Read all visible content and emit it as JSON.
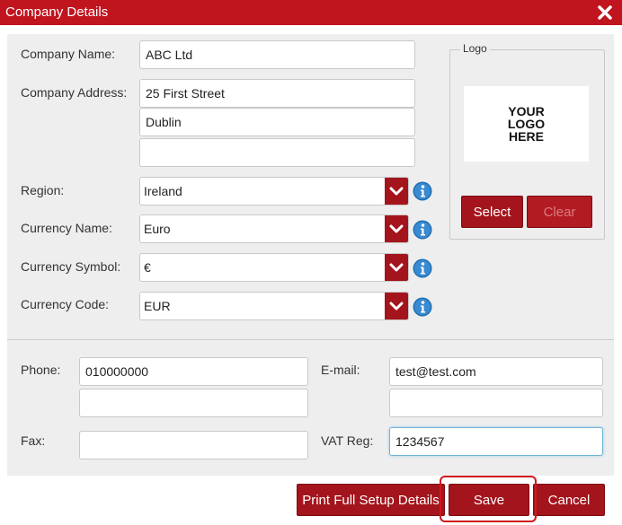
{
  "dialog": {
    "title": "Company Details",
    "close_icon": "close-icon"
  },
  "company": {
    "name_label": "Company Name:",
    "name_value": "ABC Ltd",
    "address_label": "Company Address:",
    "address_line1": "25 First Street",
    "address_line2": "Dublin",
    "address_line3": ""
  },
  "region": {
    "label": "Region:",
    "value": "Ireland"
  },
  "currency_name": {
    "label": "Currency Name:",
    "value": "Euro"
  },
  "currency_symbol": {
    "label": "Currency Symbol:",
    "value": "€"
  },
  "currency_code": {
    "label": "Currency Code:",
    "value": "EUR"
  },
  "logo": {
    "legend": "Logo",
    "placeholder_text": "YOUR\nLOGO\nHERE",
    "select_label": "Select",
    "clear_label": "Clear"
  },
  "contact": {
    "phone_label": "Phone:",
    "phone_value": "010000000",
    "phone_value2": "",
    "email_label": "E-mail:",
    "email_value": "test@test.com",
    "email_value2": "",
    "fax_label": "Fax:",
    "fax_value": "",
    "vat_label": "VAT Reg:",
    "vat_value": "1234567"
  },
  "footer": {
    "print_label": "Print Full Setup Details",
    "save_label": "Save",
    "cancel_label": "Cancel"
  },
  "colors": {
    "accent": "#c0141f",
    "button": "#a4141c",
    "panel": "#eeeeee",
    "info": "#1f6fb5"
  }
}
